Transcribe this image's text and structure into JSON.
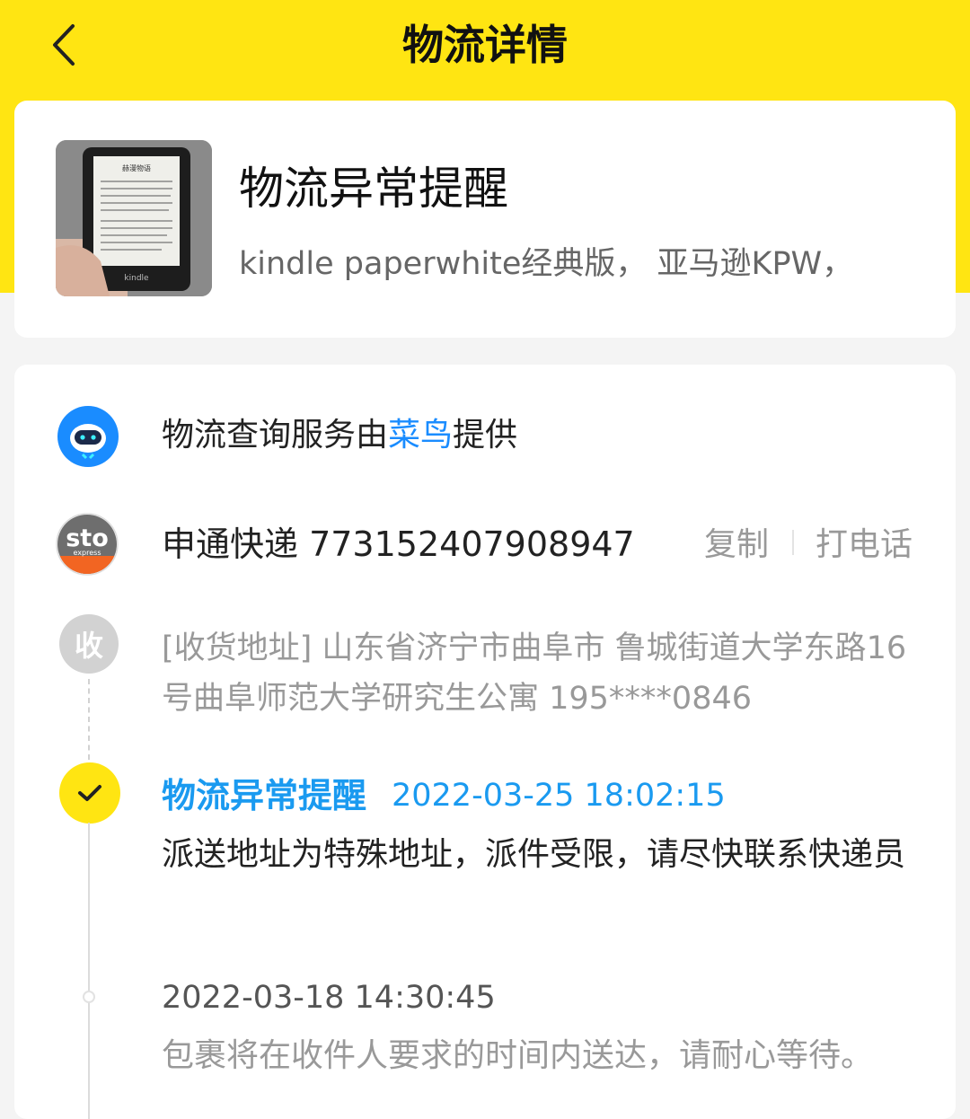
{
  "header": {
    "title": "物流详情",
    "back_icon": "chevron-left-icon"
  },
  "product": {
    "title": "物流异常提醒",
    "subtitle": "kindle paperwhite经典版， 亚马逊KPW，",
    "thumb_screen_title": "赫漫物语",
    "thumb_brand": "kindle"
  },
  "provider": {
    "prefix": "物流查询服务由",
    "link": "菜鸟",
    "suffix": "提供",
    "icon": "cainiao-icon"
  },
  "carrier": {
    "name_and_number": "申通快递 773152407908947",
    "copy_label": "复制",
    "call_label": "打电话",
    "logo_top": "sto",
    "logo_bottom": "express"
  },
  "receive": {
    "badge": "收",
    "address": "[收货地址] 山东省济宁市曲阜市 鲁城街道大学东路16号曲阜师范大学研究生公寓 195****0846"
  },
  "events": [
    {
      "title": "物流异常提醒",
      "time": "2022-03-25 18:02:15",
      "desc": "派送地址为特殊地址，派件受限，请尽快联系快递员"
    },
    {
      "time": "2022-03-18 14:30:45",
      "desc": "包裹将在收件人要求的时间内送达，请耐心等待。"
    }
  ],
  "colors": {
    "brand_yellow": "#ffe512",
    "link_blue": "#1a8cff",
    "event_blue": "#1a9af0",
    "sto_orange": "#f26522"
  }
}
